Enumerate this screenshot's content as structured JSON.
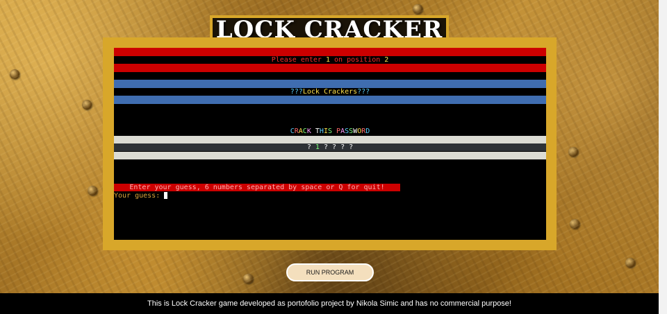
{
  "header": {
    "title": "LOCK CRACKER"
  },
  "terminal": {
    "position_message": {
      "before": "Please enter ",
      "digit": "1",
      "middle": " on position ",
      "position": "2"
    },
    "banner": {
      "left_marks": "???",
      "text": "Lock Crackers",
      "right_marks": "???"
    },
    "crack_heading": {
      "letters": [
        "C",
        "R",
        "A",
        "C",
        "K",
        " ",
        "T",
        "H",
        "I",
        "S",
        " ",
        "P",
        "A",
        "S",
        "S",
        "W",
        "O",
        "R",
        "D"
      ]
    },
    "password_slots": [
      "?",
      "1",
      "?",
      "?",
      "?",
      "?"
    ],
    "prompt": "Enter your guess, 6 numbers separated by space or Q for quit!",
    "guess_label": "Your guess:"
  },
  "controls": {
    "run_button": "RUN PROGRAM"
  },
  "footer": {
    "text": "This is Lock Cracker game developed as portofolio project by Nikola Simic and has no commercial purpose!"
  },
  "colors": {
    "frame": "#d8a72a",
    "red_band": "#cc0000",
    "blue_band": "#3f6db0",
    "terminal_bg": "#000000"
  }
}
